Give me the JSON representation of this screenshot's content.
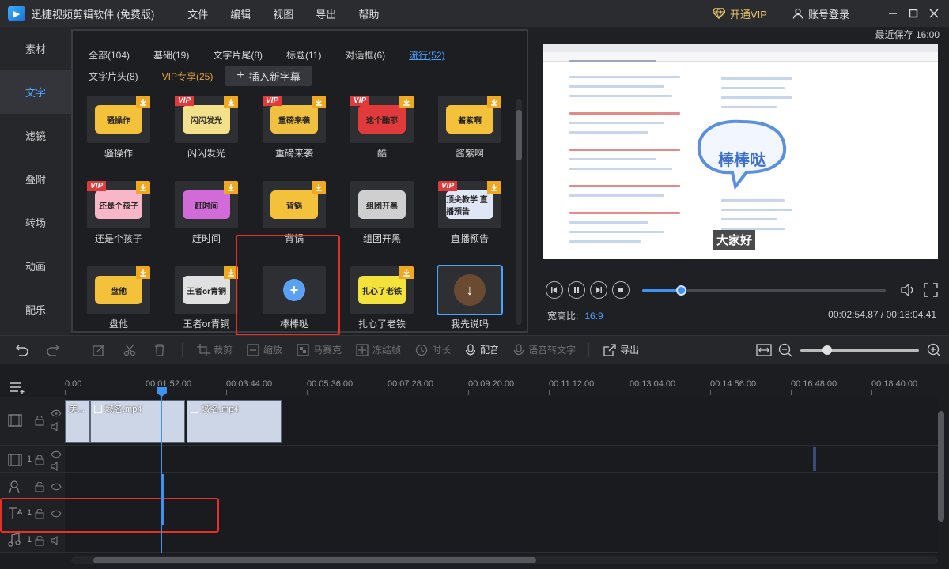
{
  "app": {
    "title": "迅捷视频剪辑软件 (免费版)",
    "menu": [
      "文件",
      "编辑",
      "视图",
      "导出",
      "帮助"
    ],
    "vip_label": "开通VIP",
    "account_label": "账号登录"
  },
  "sidebar": {
    "items": [
      "素材",
      "文字",
      "滤镜",
      "叠附",
      "转场",
      "动画",
      "配乐"
    ]
  },
  "library": {
    "categories_row1": [
      "全部(104)",
      "基础(19)",
      "文字片尾(8)",
      "标题(11)",
      "对话框(6)",
      "流行(52)"
    ],
    "categories_row2": [
      "文字片头(8)",
      "VIP专享(25)"
    ],
    "insert_button": "插入新字幕",
    "tiles": [
      {
        "label": "骚操作",
        "art": "骚操作",
        "vip": "",
        "color": "#f3c23a"
      },
      {
        "label": "闪闪发光",
        "art": "闪闪发光",
        "vip": "VIP",
        "color": "#f3e08a"
      },
      {
        "label": "重磅来袭",
        "art": "重磅来袭",
        "vip": "VIP",
        "color": "#f0c040"
      },
      {
        "label": "酷",
        "art": "这个酷耶",
        "vip": "VIP",
        "color": "#e23a3a"
      },
      {
        "label": "酱紫啊",
        "art": "酱紫啊",
        "vip": "",
        "color": "#f3c23a"
      },
      {
        "label": "还是个孩子",
        "art": "还是个孩子",
        "vip": "VIP",
        "color": "#f7b7c8"
      },
      {
        "label": "赶时间",
        "art": "赶时间",
        "vip": "",
        "color": "#d06bd8"
      },
      {
        "label": "背锅",
        "art": "背锅",
        "vip": "",
        "color": "#f3c23a"
      },
      {
        "label": "组团开黑",
        "art": "组团开黑",
        "vip": "",
        "color": "#cfcfcf"
      },
      {
        "label": "直播预告",
        "art": "顶尖教学 直播预告",
        "vip": "VIP",
        "color": "#dfe6f5"
      },
      {
        "label": "盘他",
        "art": "盘他",
        "vip": "",
        "color": "#f3c23a"
      },
      {
        "label": "王者or青铜",
        "art": "王者or青铜",
        "vip": "",
        "color": "#e0e0e0"
      },
      {
        "label": "棒棒哒",
        "art": "+",
        "vip": "",
        "color": "#5aa0f5"
      },
      {
        "label": "扎心了老铁",
        "art": "扎心了老铁",
        "vip": "",
        "color": "#f3e23a"
      },
      {
        "label": "我先说吗",
        "art": "↓",
        "vip": "",
        "color": "#d8d8d8"
      }
    ]
  },
  "preview": {
    "autosave": "最近保存 16:00",
    "bubble_text": "棒棒哒",
    "caption_text": "大家好",
    "progress": 0.16,
    "aspect_label": "宽高比:",
    "aspect_value": "16:9",
    "time_current": "00:02:54.87",
    "time_total": "00:18:04.41",
    "time_sep": "/"
  },
  "toolbar": {
    "crop": "裁剪",
    "zoom": "缩放",
    "mosaic": "马赛克",
    "freeze": "冻结帧",
    "duration": "时长",
    "dub": "配音",
    "speech_to_text": "语音转文字",
    "export": "导出"
  },
  "timeline": {
    "ticks": [
      "0.00",
      "00:01:52.00",
      "00:03:44.00",
      "00:05:36.00",
      "00:07:28.00",
      "00:09:20.00",
      "00:11:12.00",
      "00:13:04.00",
      "00:14:56.00",
      "00:16:48.00",
      "00:18:40.00"
    ],
    "clips": [
      {
        "label": "美..."
      },
      {
        "label": "域名.mp4"
      },
      {
        "label": "域名.mp4"
      }
    ],
    "track_numbers": [
      "1",
      "1",
      "1"
    ]
  },
  "colors": {
    "accent": "#4aa3ff",
    "vip": "#e8a33a",
    "highlight_box": "#e8302a"
  }
}
